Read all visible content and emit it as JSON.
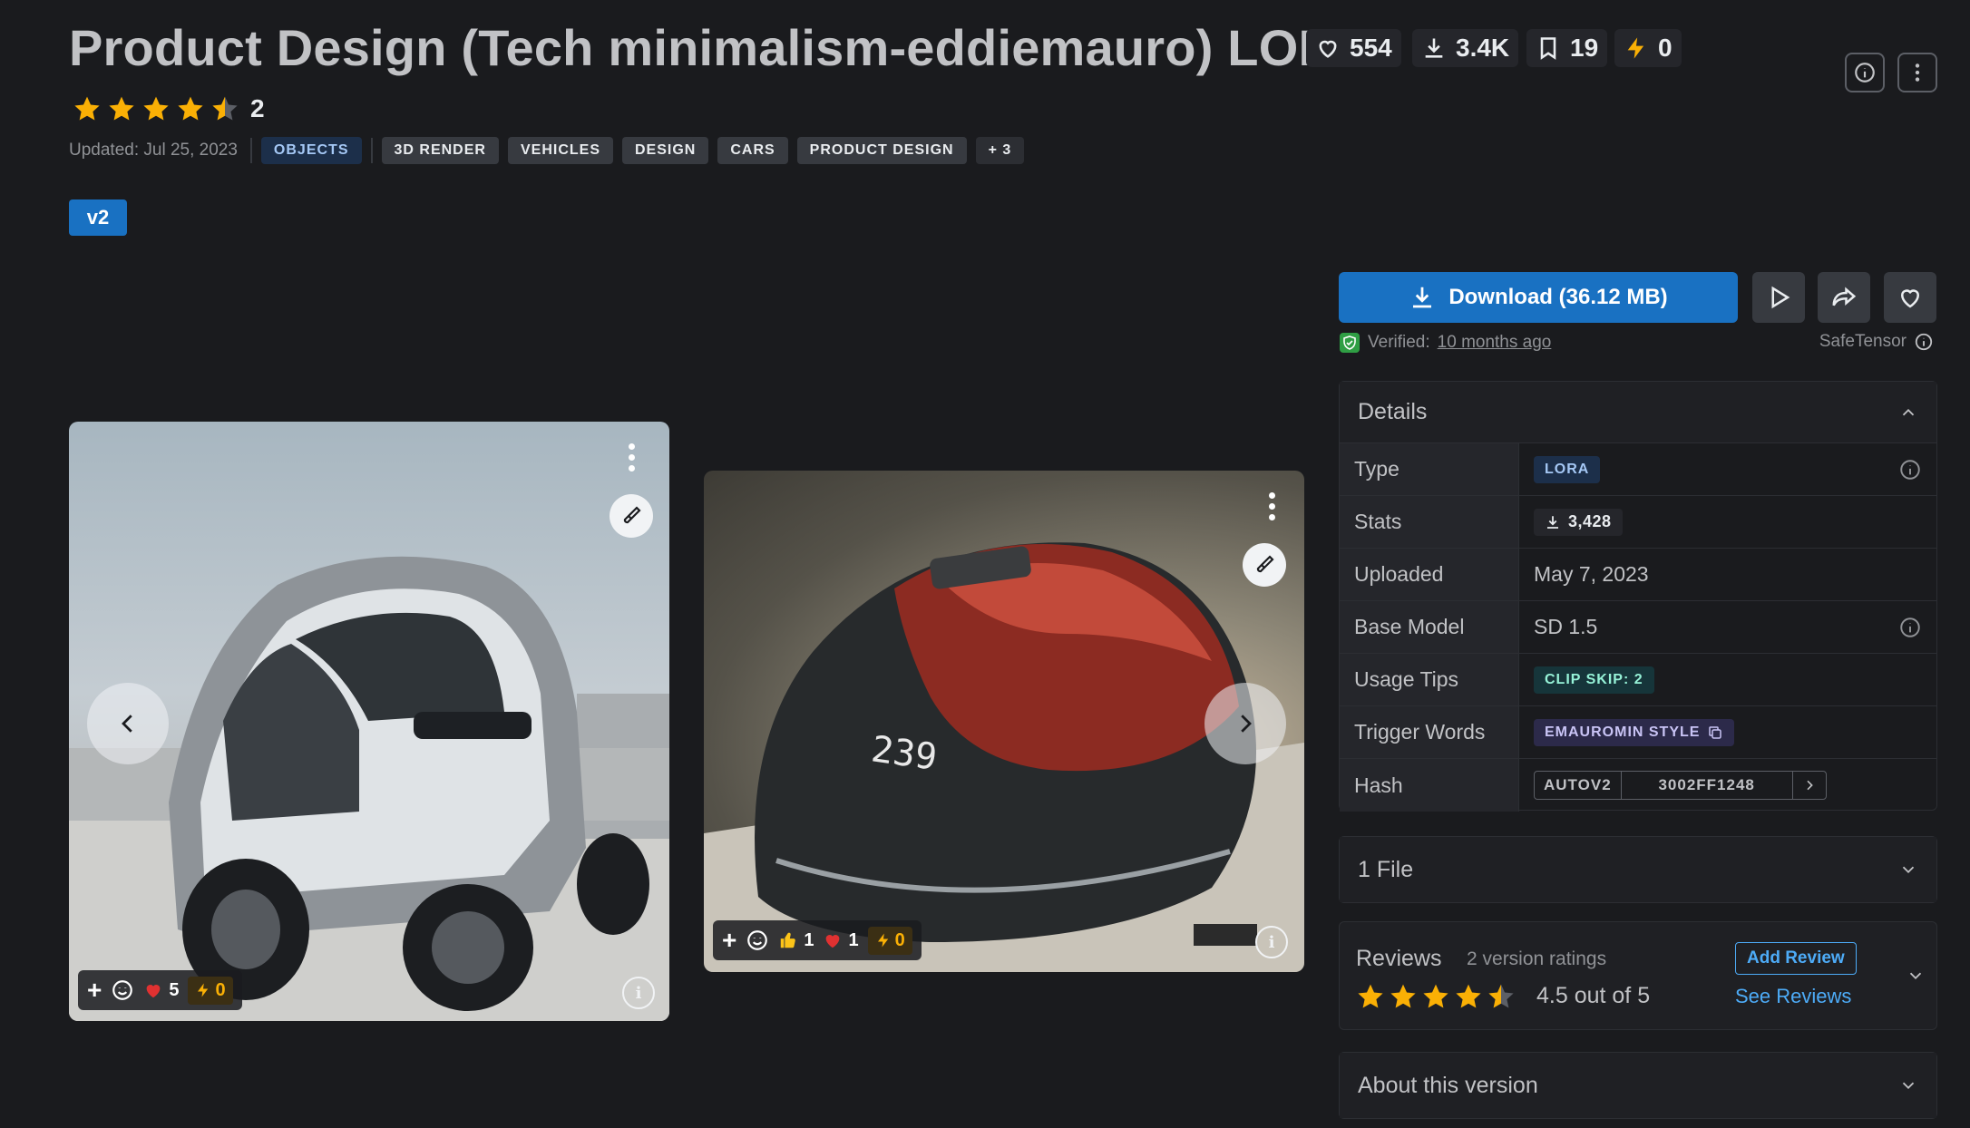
{
  "model": {
    "title": "Product Design (Tech minimalism-eddiemauro) LORA",
    "stats": {
      "likes": "554",
      "downloads": "3.4K",
      "bookmarks": "19",
      "buzz": "0"
    },
    "rating_count": "2",
    "updated": "Updated: Jul 25, 2023",
    "tags": [
      "OBJECTS",
      "3D RENDER",
      "VEHICLES",
      "DESIGN",
      "CARS",
      "PRODUCT DESIGN"
    ],
    "more_tags": "+ 3",
    "version": "v2"
  },
  "gallery": {
    "card1": {
      "hearts": "5",
      "buzz": "0"
    },
    "card2": {
      "thumbs": "1",
      "hearts": "1",
      "buzz": "0",
      "display_text": "239"
    }
  },
  "download": {
    "label": "Download (36.12 MB)",
    "verified_prefix": "Verified:",
    "verified_when": "10 months ago",
    "format": "SafeTensor"
  },
  "details": {
    "heading": "Details",
    "rows": [
      {
        "key": "Type",
        "value": "LORA"
      },
      {
        "key": "Stats",
        "value": "3,428"
      },
      {
        "key": "Uploaded",
        "value": "May 7, 2023"
      },
      {
        "key": "Base Model",
        "value": "SD 1.5"
      },
      {
        "key": "Usage Tips",
        "value": "CLIP SKIP: 2"
      },
      {
        "key": "Trigger Words",
        "value": "EMAUROMIN STYLE"
      },
      {
        "key": "Hash",
        "type": "AUTOV2",
        "value": "3002FF1248"
      }
    ]
  },
  "files": {
    "label": "1 File"
  },
  "reviews": {
    "title": "Reviews",
    "subtitle": "2 version ratings",
    "score": "4.5 out of 5",
    "add_label": "Add Review",
    "see_label": "See Reviews",
    "rating": 4.5
  },
  "about": {
    "label": "About this version"
  },
  "colors": {
    "accent": "#1971c2",
    "star": "#fab005",
    "link": "#4dabf7",
    "bg": "#1a1b1e"
  }
}
